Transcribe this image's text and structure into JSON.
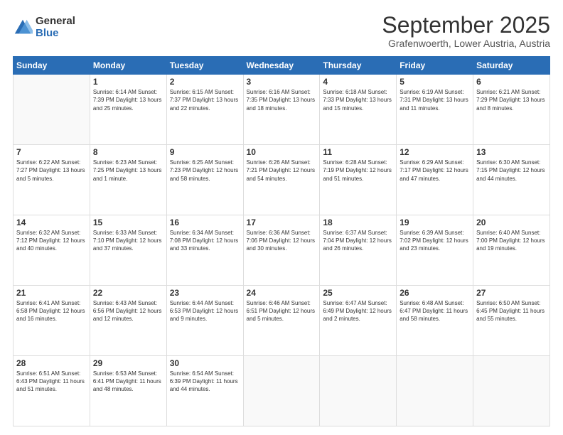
{
  "logo": {
    "general": "General",
    "blue": "Blue"
  },
  "header": {
    "month": "September 2025",
    "location": "Grafenwoerth, Lower Austria, Austria"
  },
  "days_header": [
    "Sunday",
    "Monday",
    "Tuesday",
    "Wednesday",
    "Thursday",
    "Friday",
    "Saturday"
  ],
  "weeks": [
    [
      {
        "day": "",
        "info": ""
      },
      {
        "day": "1",
        "info": "Sunrise: 6:14 AM\nSunset: 7:39 PM\nDaylight: 13 hours\nand 25 minutes."
      },
      {
        "day": "2",
        "info": "Sunrise: 6:15 AM\nSunset: 7:37 PM\nDaylight: 13 hours\nand 22 minutes."
      },
      {
        "day": "3",
        "info": "Sunrise: 6:16 AM\nSunset: 7:35 PM\nDaylight: 13 hours\nand 18 minutes."
      },
      {
        "day": "4",
        "info": "Sunrise: 6:18 AM\nSunset: 7:33 PM\nDaylight: 13 hours\nand 15 minutes."
      },
      {
        "day": "5",
        "info": "Sunrise: 6:19 AM\nSunset: 7:31 PM\nDaylight: 13 hours\nand 11 minutes."
      },
      {
        "day": "6",
        "info": "Sunrise: 6:21 AM\nSunset: 7:29 PM\nDaylight: 13 hours\nand 8 minutes."
      }
    ],
    [
      {
        "day": "7",
        "info": "Sunrise: 6:22 AM\nSunset: 7:27 PM\nDaylight: 13 hours\nand 5 minutes."
      },
      {
        "day": "8",
        "info": "Sunrise: 6:23 AM\nSunset: 7:25 PM\nDaylight: 13 hours\nand 1 minute."
      },
      {
        "day": "9",
        "info": "Sunrise: 6:25 AM\nSunset: 7:23 PM\nDaylight: 12 hours\nand 58 minutes."
      },
      {
        "day": "10",
        "info": "Sunrise: 6:26 AM\nSunset: 7:21 PM\nDaylight: 12 hours\nand 54 minutes."
      },
      {
        "day": "11",
        "info": "Sunrise: 6:28 AM\nSunset: 7:19 PM\nDaylight: 12 hours\nand 51 minutes."
      },
      {
        "day": "12",
        "info": "Sunrise: 6:29 AM\nSunset: 7:17 PM\nDaylight: 12 hours\nand 47 minutes."
      },
      {
        "day": "13",
        "info": "Sunrise: 6:30 AM\nSunset: 7:15 PM\nDaylight: 12 hours\nand 44 minutes."
      }
    ],
    [
      {
        "day": "14",
        "info": "Sunrise: 6:32 AM\nSunset: 7:12 PM\nDaylight: 12 hours\nand 40 minutes."
      },
      {
        "day": "15",
        "info": "Sunrise: 6:33 AM\nSunset: 7:10 PM\nDaylight: 12 hours\nand 37 minutes."
      },
      {
        "day": "16",
        "info": "Sunrise: 6:34 AM\nSunset: 7:08 PM\nDaylight: 12 hours\nand 33 minutes."
      },
      {
        "day": "17",
        "info": "Sunrise: 6:36 AM\nSunset: 7:06 PM\nDaylight: 12 hours\nand 30 minutes."
      },
      {
        "day": "18",
        "info": "Sunrise: 6:37 AM\nSunset: 7:04 PM\nDaylight: 12 hours\nand 26 minutes."
      },
      {
        "day": "19",
        "info": "Sunrise: 6:39 AM\nSunset: 7:02 PM\nDaylight: 12 hours\nand 23 minutes."
      },
      {
        "day": "20",
        "info": "Sunrise: 6:40 AM\nSunset: 7:00 PM\nDaylight: 12 hours\nand 19 minutes."
      }
    ],
    [
      {
        "day": "21",
        "info": "Sunrise: 6:41 AM\nSunset: 6:58 PM\nDaylight: 12 hours\nand 16 minutes."
      },
      {
        "day": "22",
        "info": "Sunrise: 6:43 AM\nSunset: 6:56 PM\nDaylight: 12 hours\nand 12 minutes."
      },
      {
        "day": "23",
        "info": "Sunrise: 6:44 AM\nSunset: 6:53 PM\nDaylight: 12 hours\nand 9 minutes."
      },
      {
        "day": "24",
        "info": "Sunrise: 6:46 AM\nSunset: 6:51 PM\nDaylight: 12 hours\nand 5 minutes."
      },
      {
        "day": "25",
        "info": "Sunrise: 6:47 AM\nSunset: 6:49 PM\nDaylight: 12 hours\nand 2 minutes."
      },
      {
        "day": "26",
        "info": "Sunrise: 6:48 AM\nSunset: 6:47 PM\nDaylight: 11 hours\nand 58 minutes."
      },
      {
        "day": "27",
        "info": "Sunrise: 6:50 AM\nSunset: 6:45 PM\nDaylight: 11 hours\nand 55 minutes."
      }
    ],
    [
      {
        "day": "28",
        "info": "Sunrise: 6:51 AM\nSunset: 6:43 PM\nDaylight: 11 hours\nand 51 minutes."
      },
      {
        "day": "29",
        "info": "Sunrise: 6:53 AM\nSunset: 6:41 PM\nDaylight: 11 hours\nand 48 minutes."
      },
      {
        "day": "30",
        "info": "Sunrise: 6:54 AM\nSunset: 6:39 PM\nDaylight: 11 hours\nand 44 minutes."
      },
      {
        "day": "",
        "info": ""
      },
      {
        "day": "",
        "info": ""
      },
      {
        "day": "",
        "info": ""
      },
      {
        "day": "",
        "info": ""
      }
    ]
  ]
}
